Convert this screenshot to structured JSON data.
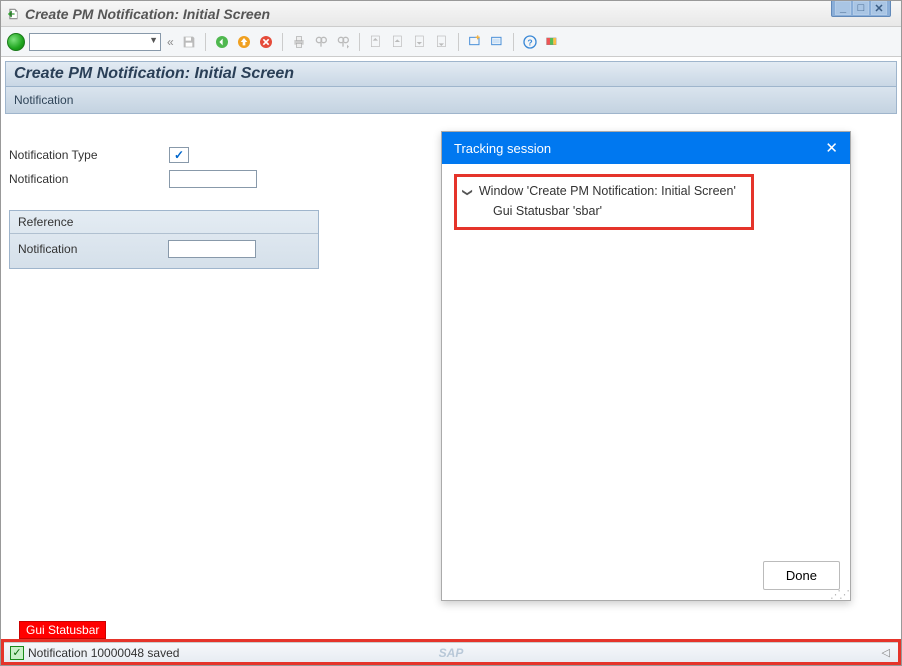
{
  "window": {
    "title": "Create PM Notification: Initial Screen"
  },
  "header": {
    "title": "Create PM Notification: Initial Screen"
  },
  "subheader": {
    "label": "Notification"
  },
  "form": {
    "notificationTypeLabel": "Notification Type",
    "notificationTypeChecked": "✓",
    "notificationLabel": "Notification",
    "notificationValue": ""
  },
  "reference": {
    "legend": "Reference",
    "notificationLabel": "Notification",
    "notificationValue": ""
  },
  "tracking": {
    "title": "Tracking session",
    "tree": {
      "root": "Window 'Create PM Notification: Initial Screen'",
      "child": "Gui Statusbar 'sbar'"
    },
    "doneLabel": "Done"
  },
  "statusbarTag": "Gui Statusbar",
  "statusbar": {
    "message": "Notification 10000048 saved",
    "brand": "SAP"
  },
  "toolbar": {
    "collapse": "«"
  }
}
